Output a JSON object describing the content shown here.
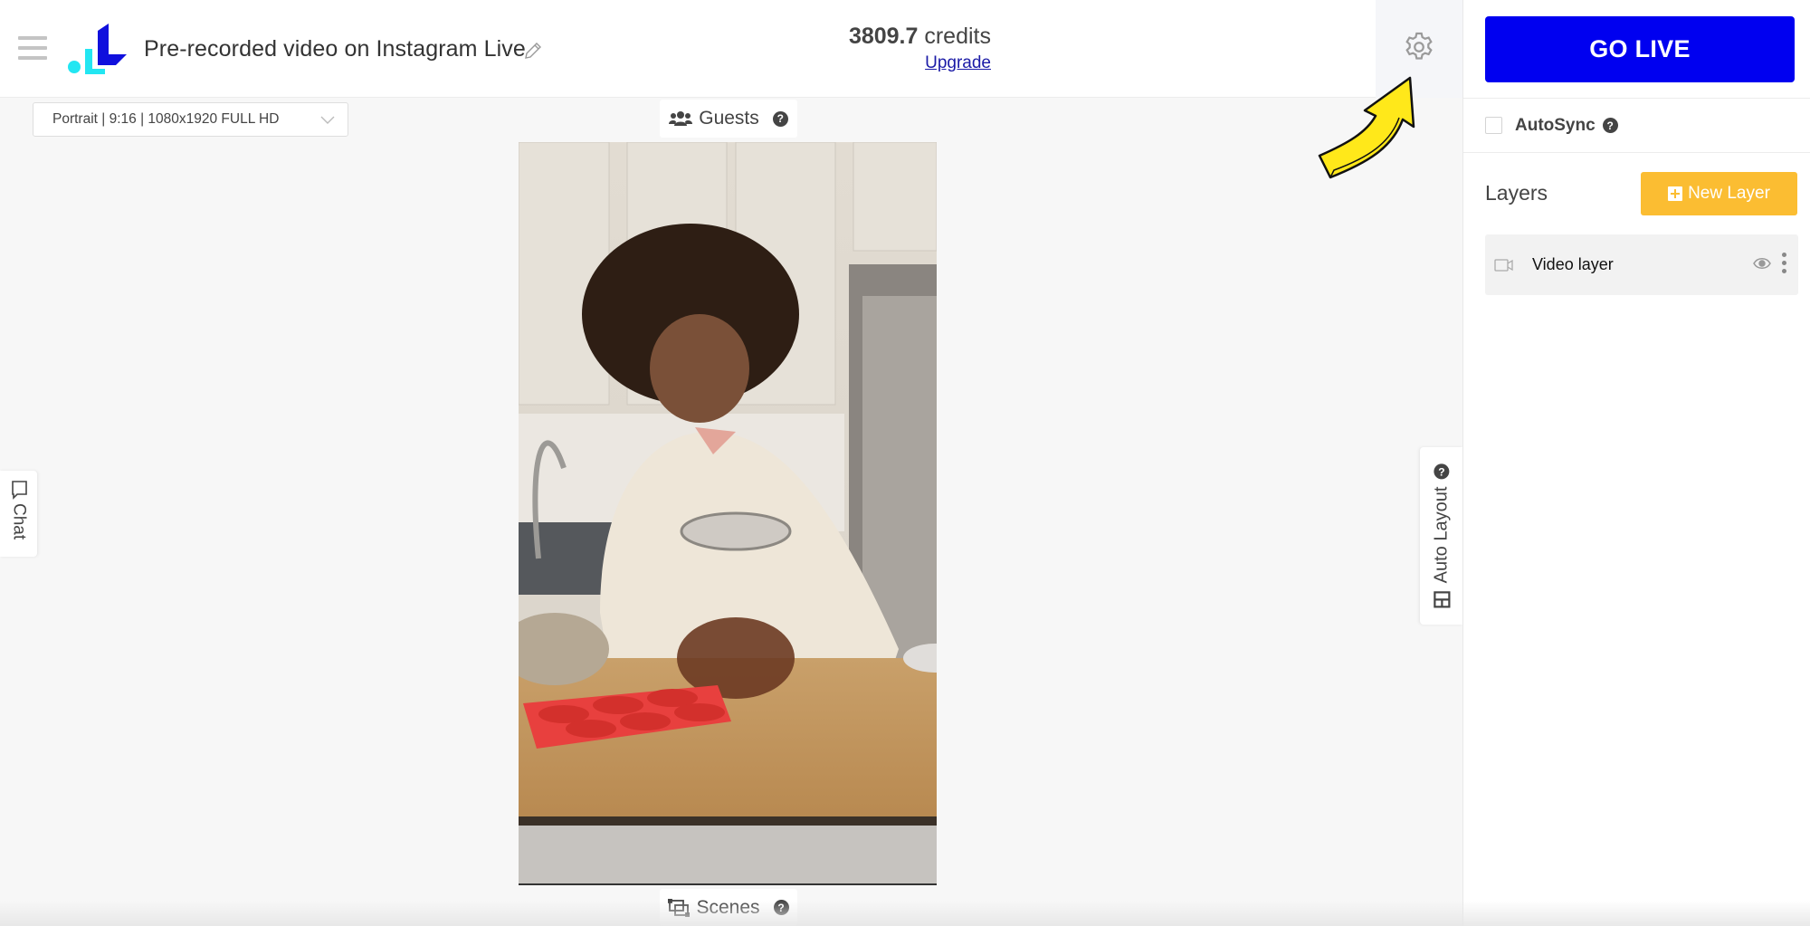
{
  "header": {
    "title": "Pre-recorded video on Instagram Live",
    "credits_value": "3809.7",
    "credits_label": "credits",
    "upgrade_label": "Upgrade"
  },
  "colors": {
    "go_live_bg": "#0000f0",
    "new_layer_bg": "#fbbd32",
    "logo_blue": "#1010dd",
    "logo_cyan": "#22e6f2"
  },
  "right_panel": {
    "go_live_label": "GO LIVE",
    "autosync_label": "AutoSync",
    "autosync_checked": false,
    "layers_title": "Layers",
    "new_layer_label": "New Layer",
    "layers": [
      {
        "name": "Video layer",
        "icon": "video-camera-icon",
        "visible": true
      }
    ]
  },
  "canvas": {
    "format_select_value": "Portrait | 9:16 | 1080x1920 FULL HD",
    "guests_label": "Guests",
    "scenes_label": "Scenes",
    "chat_label": "Chat",
    "auto_layout_label": "Auto Layout",
    "help_glyph": "?"
  }
}
